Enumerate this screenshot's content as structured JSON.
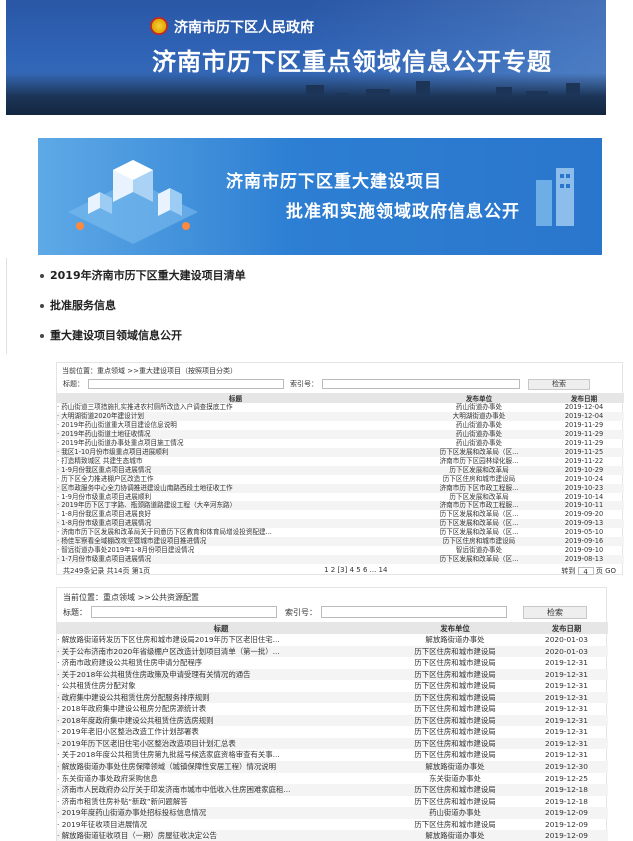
{
  "header": {
    "gov_name": "济南市历下区人民政府",
    "title": "济南市历下区重点领域信息公开专题"
  },
  "sub_banner": {
    "line1": "济南市历下区重大建设项目",
    "line2": "批准和实施领域政府信息公开"
  },
  "menu": [
    "2019年济南市历下区重大建设项目清单",
    "批准服务信息",
    "重大建设项目领域信息公开"
  ],
  "panel1": {
    "breadcrumb": "当前位置：重点领域 >>重大建设项目（按照项目分类）",
    "title_label": "标题：",
    "index_label": "索引号：",
    "search_button": "检索",
    "columns": [
      "标题",
      "发布单位",
      "发布日期"
    ],
    "rows": [
      [
        "· 药山街道三项措施扎实推进农村厕所改造入户调查摸底工作",
        "药山街道办事处",
        "2019-12-04"
      ],
      [
        "· 大明湖街道2020年建设计划",
        "大明湖街道办事处",
        "2019-12-04"
      ],
      [
        "· 2019年药山街道重大项目建设信息说明",
        "药山街道办事处",
        "2019-11-29"
      ],
      [
        "· 2019年药山街道土地征收情况",
        "药山街道办事处",
        "2019-11-29"
      ],
      [
        "· 2019年药山街道办事处重点项目施工情况",
        "药山街道办事处",
        "2019-11-29"
      ],
      [
        "· 我区1-10月份市级重点项目进展顺利",
        "历下区发展和改革局（区...",
        "2019-11-25"
      ],
      [
        "· 打造精致城区 共建生态城市",
        "济南市历下区园林绿化服...",
        "2019-11-22"
      ],
      [
        "· 1-9月份我区重点项目进展情况",
        "历下区发展和改革局",
        "2019-10-29"
      ],
      [
        "· 历下区全力推进棚户区改造工作",
        "历下区住房和城市建设局",
        "2019-10-24"
      ],
      [
        "· 区市政服务中心全力协调推进建设山南路西段土地征收工作",
        "济南市历下区市政工程服...",
        "2019-10-23"
      ],
      [
        "· 1-9月份市级重点项目进展顺利",
        "历下区发展和改革局",
        "2019-10-14"
      ],
      [
        "· 2019年历下区丁字路、瓶颈路道路建设工程（大辛河东路）",
        "济南市历下区市政工程服...",
        "2019-10-11"
      ],
      [
        "· 1-8月份我区重点项目进展良好",
        "历下区发展和改革局（区...",
        "2019-09-20"
      ],
      [
        "· 1-8月份市级重点项目进展情况",
        "历下区发展和改革局（区...",
        "2019-09-13"
      ],
      [
        "· 济南市历下区发展和改革局关于同意历下区教育和体育局增设投资配建...",
        "历下区发展和改革局（区...",
        "2019-05-10"
      ],
      [
        "· 杨佳军察看全域棚改攻坚暨城市建设项目推进情况",
        "历下区住房和城市建设局",
        "2019-09-16"
      ],
      [
        "· 智远街道办事处2019年1-8月份项目建设情况",
        "智远街道办事处",
        "2019-09-10"
      ],
      [
        "· 1-7月份市级重点项目进展情况",
        "历下区发展和改革局（区...",
        "2019-08-13"
      ]
    ],
    "total": "共249条记录 共14页 第1页",
    "pages": "1  2  [3]  4  5  6 ...  14",
    "goto_label": "转到",
    "goto_value": "4",
    "goto_unit": "页",
    "goto_button": "GO"
  },
  "panel2": {
    "breadcrumb": "当前位置：重点领域 >>公共资源配置",
    "title_label": "标题：",
    "index_label": "索引号：",
    "search_button": "检索",
    "columns": [
      "标题",
      "发布单位",
      "发布日期"
    ],
    "rows": [
      [
        "· 解放路街道转发历下区住房和城市建设局2019年历下区老旧住宅...",
        "解放路街道办事处",
        "2020-01-03"
      ],
      [
        "· 关于公布济南市2020年省级棚户区改造计划项目清单（第一批）...",
        "历下区住房和城市建设局",
        "2020-01-03"
      ],
      [
        "· 济南市政府建设公共租赁住房申请分配程序",
        "历下区住房和城市建设局",
        "2019-12-31"
      ],
      [
        "· 关于2018年公共租赁住房政策及申请受理有关情况的通告",
        "历下区住房和城市建设局",
        "2019-12-31"
      ],
      [
        "· 公共租赁住房分配对象",
        "历下区住房和城市建设局",
        "2019-12-31"
      ],
      [
        "· 政府集中建设公共租赁住房分配服务排序规则",
        "历下区住房和城市建设局",
        "2019-12-31"
      ],
      [
        "· 2018年政府集中建设公租房分配房源统计表",
        "历下区住房和城市建设局",
        "2019-12-31"
      ],
      [
        "· 2018年度政府集中建设公共租赁住房选房规则",
        "历下区住房和城市建设局",
        "2019-12-31"
      ],
      [
        "· 2019年老旧小区整治改造工作计划部署表",
        "历下区住房和城市建设局",
        "2019-12-31"
      ],
      [
        "· 2019年历下区老旧住宅小区整治改造项目计划汇总表",
        "历下区住房和城市建设局",
        "2019-12-31"
      ],
      [
        "· 关于2018年度公共租赁住房第九批摇号候选家庭资格审查有关事...",
        "历下区住房和城市建设局",
        "2019-12-31"
      ],
      [
        "· 解放路街道办事处住房保障领域（城镇保障性安居工程）情况说明",
        "解放路街道办事处",
        "2019-12-30"
      ],
      [
        "· 东关街道办事处政府采购信息",
        "东关街道办事处",
        "2019-12-25"
      ],
      [
        "· 济南市人民政府办公厅关于印发济南市城市中低收入住房困难家庭租...",
        "历下区住房和城市建设局",
        "2019-12-18"
      ],
      [
        "· 济南市租赁住房补贴“新政”新问题解答",
        "历下区住房和城市建设局",
        "2019-12-18"
      ],
      [
        "· 2019年度药山街道办事处招标投标信息情况",
        "药山街道办事处",
        "2019-12-09"
      ],
      [
        "· 2019年征收项目进展情况",
        "历下区住房和城市建设局",
        "2019-12-09"
      ],
      [
        "· 解放路街道征收项目（一期）房屋征收决定公告",
        "解放路街道办事处",
        "2019-12-09"
      ]
    ]
  },
  "colors": {
    "banner": "#2f63b5",
    "sub_banner": "#2d7fd3",
    "table_header": "#e6e6e6"
  }
}
